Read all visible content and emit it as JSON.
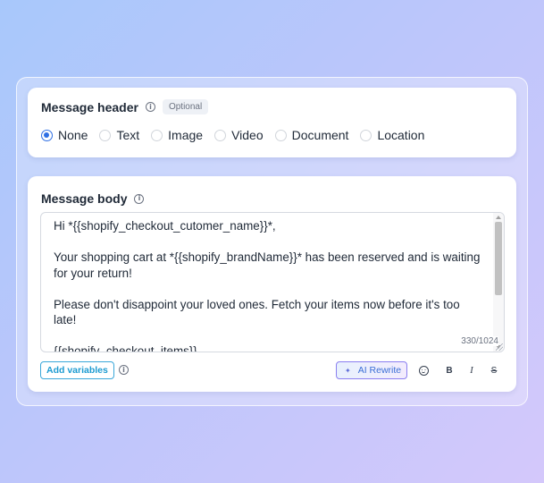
{
  "header_card": {
    "title": "Message header",
    "optional_badge": "Optional",
    "options": [
      {
        "label": "None",
        "checked": true
      },
      {
        "label": "Text",
        "checked": false
      },
      {
        "label": "Image",
        "checked": false
      },
      {
        "label": "Video",
        "checked": false
      },
      {
        "label": "Document",
        "checked": false
      },
      {
        "label": "Location",
        "checked": false
      }
    ]
  },
  "body_card": {
    "title": "Message body",
    "message": "Hi *{{shopify_checkout_cutomer_name}}*,\n\nYour shopping cart at *{{shopify_brandName}}* has been reserved and is waiting for your return!\n\nPlease don't disappoint your loved ones. Fetch your items now before it's too late!\n\n{{shopify_checkout_items}}",
    "char_count": "330/1024",
    "add_variables_label": "Add variables",
    "ai_rewrite_label": "AI Rewrite",
    "format_bold": "B",
    "format_italic": "I",
    "format_strike": "S"
  },
  "icons": {
    "info": "info-icon",
    "sparkle": "sparkle-icon",
    "emoji": "emoji-icon"
  },
  "colors": {
    "accent": "#2f6fe4",
    "add_variables": "#1d9bd1",
    "ai_border": "#8b7ff0"
  }
}
